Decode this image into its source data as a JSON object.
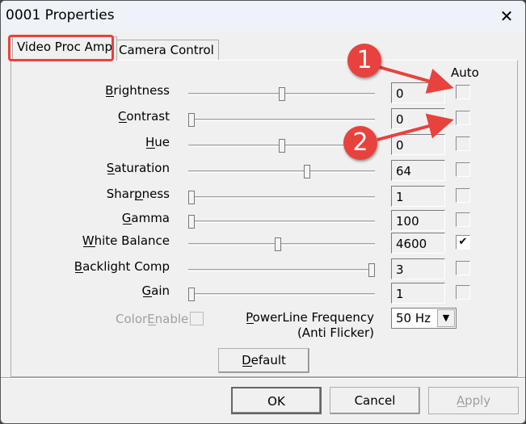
{
  "window": {
    "title": "0001 Properties",
    "close_icon": "close-icon"
  },
  "tabs": [
    {
      "label": "Video Proc Amp",
      "active": true
    },
    {
      "label": "Camera Control",
      "active": false
    }
  ],
  "auto_header": "Auto",
  "controls": [
    {
      "label": "Brightness",
      "mnemonic": 0,
      "value": "0",
      "slider_percent": 50,
      "auto": false
    },
    {
      "label": "Contrast",
      "mnemonic": 0,
      "value": "0",
      "slider_percent": 0,
      "auto": false
    },
    {
      "label": "Hue",
      "mnemonic": 0,
      "value": "0",
      "slider_percent": 50,
      "auto": false
    },
    {
      "label": "Saturation",
      "mnemonic": 0,
      "value": "64",
      "slider_percent": 64,
      "auto": false
    },
    {
      "label": "Sharpness",
      "mnemonic": 4,
      "value": "1",
      "slider_percent": 0,
      "auto": false
    },
    {
      "label": "Gamma",
      "mnemonic": 0,
      "value": "100",
      "slider_percent": 0,
      "auto": false
    },
    {
      "label": "White Balance",
      "mnemonic": 0,
      "value": "4600",
      "slider_percent": 48,
      "auto": true
    },
    {
      "label": "Backlight Comp",
      "mnemonic": 0,
      "value": "3",
      "slider_percent": 100,
      "auto": false
    },
    {
      "label": "Gain",
      "mnemonic": 0,
      "value": "1",
      "slider_percent": 0,
      "auto": false
    }
  ],
  "color_enable": {
    "label": "ColorEnable",
    "mnemonic": 5,
    "checked": false,
    "disabled": true
  },
  "powerline": {
    "label": "PowerLine Frequency",
    "sublabel": "(Anti Flicker)",
    "value": "50 Hz"
  },
  "buttons": {
    "default": "Default",
    "ok": "OK",
    "cancel": "Cancel",
    "apply": "Apply"
  },
  "annotations": [
    {
      "number": "1"
    },
    {
      "number": "2"
    }
  ],
  "colors": {
    "annotation": "#e8423e",
    "tab_highlight": "#e8423e"
  }
}
